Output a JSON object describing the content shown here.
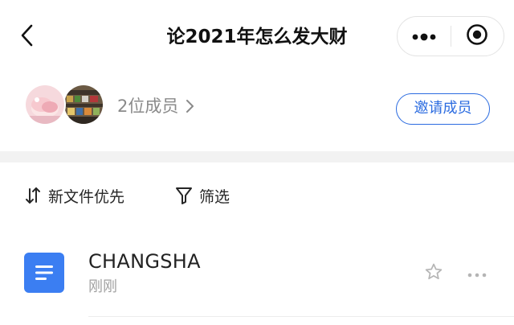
{
  "header": {
    "title": "论2021年怎么发大财",
    "back_icon": "chevron-left-icon",
    "more_icon": "more-dots-icon",
    "close_icon": "record-circle-icon"
  },
  "members": {
    "count_text": "2位成员",
    "avatars": [
      "avatar-pink-plush",
      "avatar-store-shelves"
    ],
    "invite_label": "邀请成员"
  },
  "toolbar": {
    "sort_label": "新文件优先",
    "sort_icon": "sort-arrows-icon",
    "filter_label": "筛选",
    "filter_icon": "funnel-icon"
  },
  "files": [
    {
      "name": "CHANGSHA",
      "time": "刚刚",
      "type_icon": "document-icon",
      "starred": false
    }
  ],
  "colors": {
    "accent": "#2c6ce0",
    "doc_icon": "#3b7ef2",
    "divider_band": "#f2f2f2",
    "muted_text": "#8a8a8a"
  }
}
